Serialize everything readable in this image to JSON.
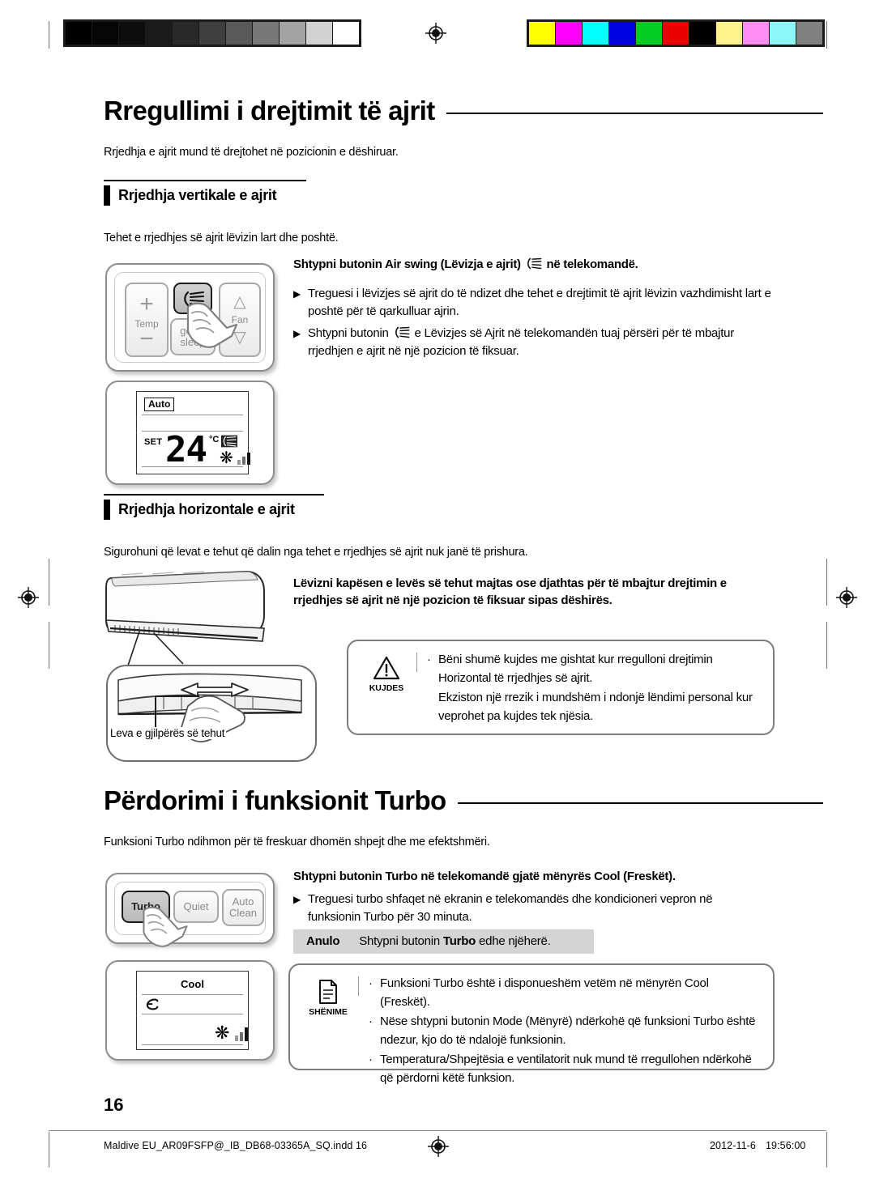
{
  "document": {
    "page_number": "16",
    "footer_file": "Maldive EU_AR09FSFP@_IB_DB68-03365A_SQ.indd   16",
    "footer_date": "2012-11-6",
    "footer_time": "19:56:00"
  },
  "calibration": {
    "gray_swatches": [
      "#000000",
      "#050505",
      "#0d0d0d",
      "#1a1a1a",
      "#282828",
      "#3f3f3f",
      "#595959",
      "#787878",
      "#a3a3a3",
      "#d2d2d2",
      "#ffffff"
    ],
    "color_swatches": [
      "#ffff00",
      "#ff00ff",
      "#00ffff",
      "#0000e0",
      "#00cc22",
      "#ee0000",
      "#000000",
      "#fff28a",
      "#ff8cf0",
      "#8cf7f7",
      "#808080"
    ]
  },
  "section1": {
    "title": "Rregullimi i drejtimit të ajrit",
    "intro": "Rrjedhja e ajrit mund të drejtohet në pozicionin e dëshiruar.",
    "sub1": {
      "title": "Rrjedhja vertikale e ajrit",
      "intro": "Tehet e rrjedhjes së ajrit lëvizin lart dhe poshtë.",
      "lead_a": "Shtypni butonin Air swing (Lëvizja e ajrit)",
      "lead_b": "në telekomandë.",
      "bullets": [
        "Treguesi i lëvizjes së ajrit do të ndizet dhe tehet e drejtimit të ajrit lëvizin vazhdimisht lart e poshtë për të qarkulluar ajrin.",
        "Shtypni butonin"
      ],
      "bullet2_tail": "e Lëvizjes së Ajrit në telekomandën tuaj përsëri për të mbajtur rrjedhjen e ajrit në një pozicion të fiksuar."
    },
    "sub2": {
      "title": "Rrjedhja horizontale e ajrit",
      "intro": "Sigurohuni që levat e tehut që dalin nga tehet e rrjedhjes së ajrit nuk janë të prishura.",
      "lead": "Lëvizni kapësen e levës së tehut majtas ose djathtas për të mbajtur drejtimin e rrjedhjes së ajrit në një pozicion të fiksuar sipas dëshirës.",
      "unit_label": "Leva e gjilpërës së tehut",
      "caution": {
        "caption": "KUJDES",
        "lines": [
          "Bëni shumë kujdes me gishtat kur rregulloni drejtimin Horizontal të rrjedhjes së ajrit.",
          "Ekziston një rrezik i mundshëm i ndonjë lëndimi personal kur veprohet pa kujdes tek njësia."
        ]
      }
    }
  },
  "section2": {
    "title": "Përdorimi i funksionit Turbo",
    "intro": "Funksioni Turbo ndihmon për të freskuar dhomën shpejt dhe me efektshmëri.",
    "lead_pre": "Shtypni butonin",
    "lead_strong": "Turbo",
    "lead_post": "në telekomandë gjatë mënyrës Cool (Freskët).",
    "bullet": "Treguesi turbo shfaqet në ekranin e telekomandës dhe kondicioneri vepron në funksionin Turbo për 30 minuta.",
    "cancel_label": "Anulo",
    "cancel_pre": "Shtypni butonin",
    "cancel_strong": "Turbo",
    "cancel_post": "edhe njëherë.",
    "note": {
      "caption": "SHËNIME",
      "items": [
        "Funksioni Turbo është i disponueshëm vetëm në mënyrën Cool (Freskët).",
        "Nëse shtypni butonin Mode (Mënyrë) ndërkohë që funksioni Turbo është ndezur, kjo do të ndalojë funksionin.",
        "Temperatura/Shpejtësia e ventilatorit nuk mund të rregullohen ndërkohë që përdorni këtë funksion."
      ]
    }
  },
  "remote1": {
    "temp_label": "Temp",
    "plus": "+",
    "minus": "−",
    "fan_label": "Fan",
    "sleep_line1": "good'",
    "sleep_line2": "sleep"
  },
  "lcd1": {
    "mode": "Auto",
    "set_label": "SET",
    "temperature": "24",
    "unit": "°C"
  },
  "remote2": {
    "turbo": "Turbo",
    "quiet": "Quiet",
    "auto": "Auto",
    "clean": "Clean"
  },
  "lcd2": {
    "mode": "Cool"
  }
}
